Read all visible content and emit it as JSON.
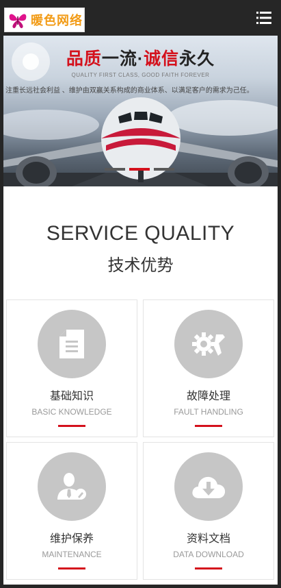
{
  "header": {
    "logo_text": "暖色网络",
    "menu_icon": "list-menu-icon"
  },
  "banner": {
    "slogan_part1": "品质",
    "slogan_part2": "一流·",
    "slogan_part3": "诚信",
    "slogan_part4": "永久",
    "subtitle": "QUALITY FIRST CLASS, GOOD FAITH FOREVER",
    "description": "注重长远社会利益 、维护由双赢关系构成的商业体系、以满足客户的需求为己任。",
    "slide_count": 3,
    "active_slide": 2
  },
  "section": {
    "title_en": "SERVICE QUALITY",
    "title_cn": "技术优势"
  },
  "services": [
    {
      "cn": "基础知识",
      "en": "BASIC KNOWLEDGE",
      "icon": "document-icon"
    },
    {
      "cn": "故障处理",
      "en": "FAULT HANDLING",
      "icon": "gears-icon"
    },
    {
      "cn": "维护保养",
      "en": "MAINTENANCE",
      "icon": "support-person-icon"
    },
    {
      "cn": "资料文档",
      "en": "DATA DOWNLOAD",
      "icon": "cloud-download-icon"
    }
  ],
  "colors": {
    "accent": "#d4111c",
    "header_bg": "#262626",
    "icon_circle": "#c6c6c6",
    "logo_text": "#f29b16"
  }
}
